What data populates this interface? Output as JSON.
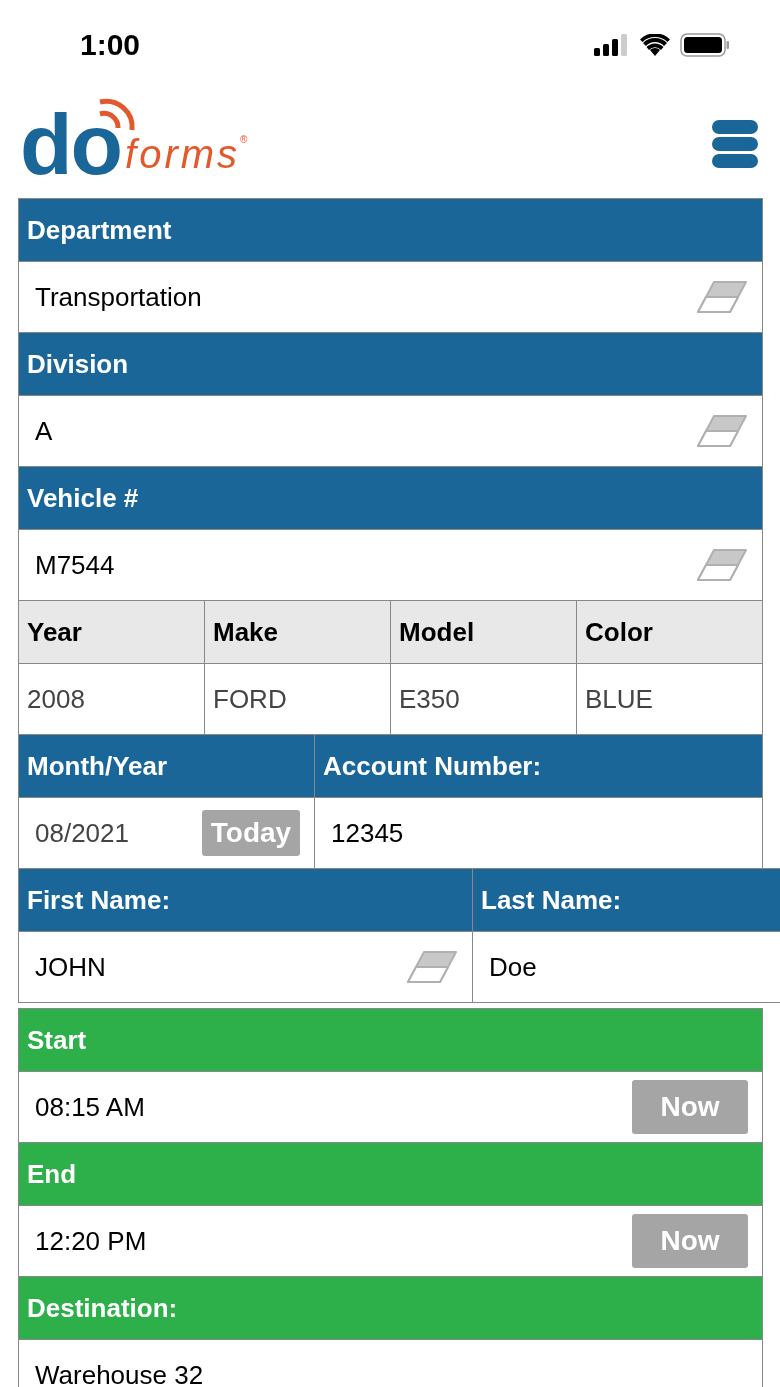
{
  "status_bar": {
    "time": "1:00"
  },
  "logo": {
    "mark": "do",
    "word": "forms",
    "registered": "®"
  },
  "groups": [
    {
      "color": "#1a6699",
      "rows": [
        {
          "kind": "banner",
          "cells": [
            {
              "label": "Department",
              "value": "Transportation",
              "clearable": true,
              "readonly": false
            }
          ]
        },
        {
          "kind": "banner",
          "cells": [
            {
              "label": "Division",
              "value": "A",
              "clearable": true,
              "readonly": false
            }
          ]
        },
        {
          "kind": "banner",
          "cells": [
            {
              "label": "Vehicle #",
              "value": "M7544",
              "clearable": true,
              "readonly": false
            }
          ]
        },
        {
          "kind": "grid",
          "cells": [
            {
              "label": "Year",
              "value": "2008",
              "clearable": false,
              "readonly": true
            },
            {
              "label": "Make",
              "value": "FORD",
              "clearable": false,
              "readonly": true
            },
            {
              "label": "Model",
              "value": "E350",
              "clearable": false,
              "readonly": true
            },
            {
              "label": "Color",
              "value": "BLUE",
              "clearable": false,
              "readonly": true
            }
          ]
        },
        {
          "kind": "banner",
          "cells": [
            {
              "label": "Month/Year",
              "value": "08/2021",
              "clearable": false,
              "readonly": true,
              "button": "Today"
            },
            {
              "label": "Account Number:",
              "value": "12345",
              "clearable": false,
              "readonly": false
            }
          ]
        },
        {
          "kind": "banner",
          "cells": [
            {
              "label": "First Name:",
              "value": "JOHN",
              "clearable": true,
              "readonly": false
            },
            {
              "label": "Last Name:",
              "value": "Doe",
              "clearable": false,
              "readonly": false
            }
          ]
        }
      ]
    },
    {
      "color": "#2daf4a",
      "rows": [
        {
          "kind": "banner",
          "cells": [
            {
              "label": "Start",
              "value": "08:15 AM",
              "clearable": false,
              "readonly": false,
              "button": "Now"
            }
          ]
        },
        {
          "kind": "banner",
          "cells": [
            {
              "label": "End",
              "value": "12:20 PM",
              "clearable": false,
              "readonly": false,
              "button": "Now"
            }
          ]
        },
        {
          "kind": "banner",
          "cells": [
            {
              "label": "Destination:",
              "value": "Warehouse 32",
              "clearable": false,
              "readonly": false
            }
          ]
        }
      ]
    }
  ]
}
